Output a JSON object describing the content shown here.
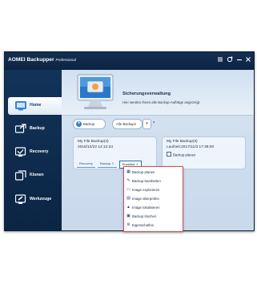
{
  "window": {
    "app_name": "AOMEI Backupper",
    "edition": "Professional",
    "controls": [
      "menu-icon",
      "refresh-icon",
      "minimize-icon",
      "close-icon"
    ]
  },
  "sidebar": {
    "items": [
      {
        "label": "Home",
        "icon": "home-icon",
        "active": true
      },
      {
        "label": "Backup",
        "icon": "backup-icon",
        "active": false
      },
      {
        "label": "Recovery",
        "icon": "recovery-icon",
        "active": false
      },
      {
        "label": "Klonen",
        "icon": "clone-icon",
        "active": false
      },
      {
        "label": "Werkzeuge",
        "icon": "tools-icon",
        "active": false
      }
    ]
  },
  "hero": {
    "title": "Sicherungsverwaltung",
    "subtitle": "Hier werden Ihnen alle Backup-Aufträge angezeigt."
  },
  "toolbar": {
    "backup_label": "Backup",
    "filter_value": "Alle Backups"
  },
  "cards": [
    {
      "name": "My File Backup(4)",
      "date": "2016/12/22 14:12:34",
      "buttons": [
        "Recovery",
        "Backup",
        "Erweitert"
      ]
    },
    {
      "name": "My File Backup(3)",
      "date": "Laufzeit:2017/11/3 17:38:00",
      "checkbox_label": "Backup planen"
    }
  ],
  "menu": {
    "items": [
      {
        "label": "Backup planen",
        "icon": "schedule-icon"
      },
      {
        "label": "Backup bearbeiten",
        "icon": "edit-icon"
      },
      {
        "label": "Image explorieren",
        "icon": "explore-icon"
      },
      {
        "label": "Image überprüfen",
        "icon": "check-icon"
      },
      {
        "label": "Image lokalisieren",
        "icon": "locate-icon"
      },
      {
        "label": "Backup löschen",
        "icon": "delete-icon"
      },
      {
        "label": "Eigenschaften",
        "icon": "properties-icon"
      }
    ]
  },
  "colors": {
    "sidebar_bg": "#0c2848",
    "accent": "#2f7fd4",
    "menu_border": "#d05050"
  }
}
